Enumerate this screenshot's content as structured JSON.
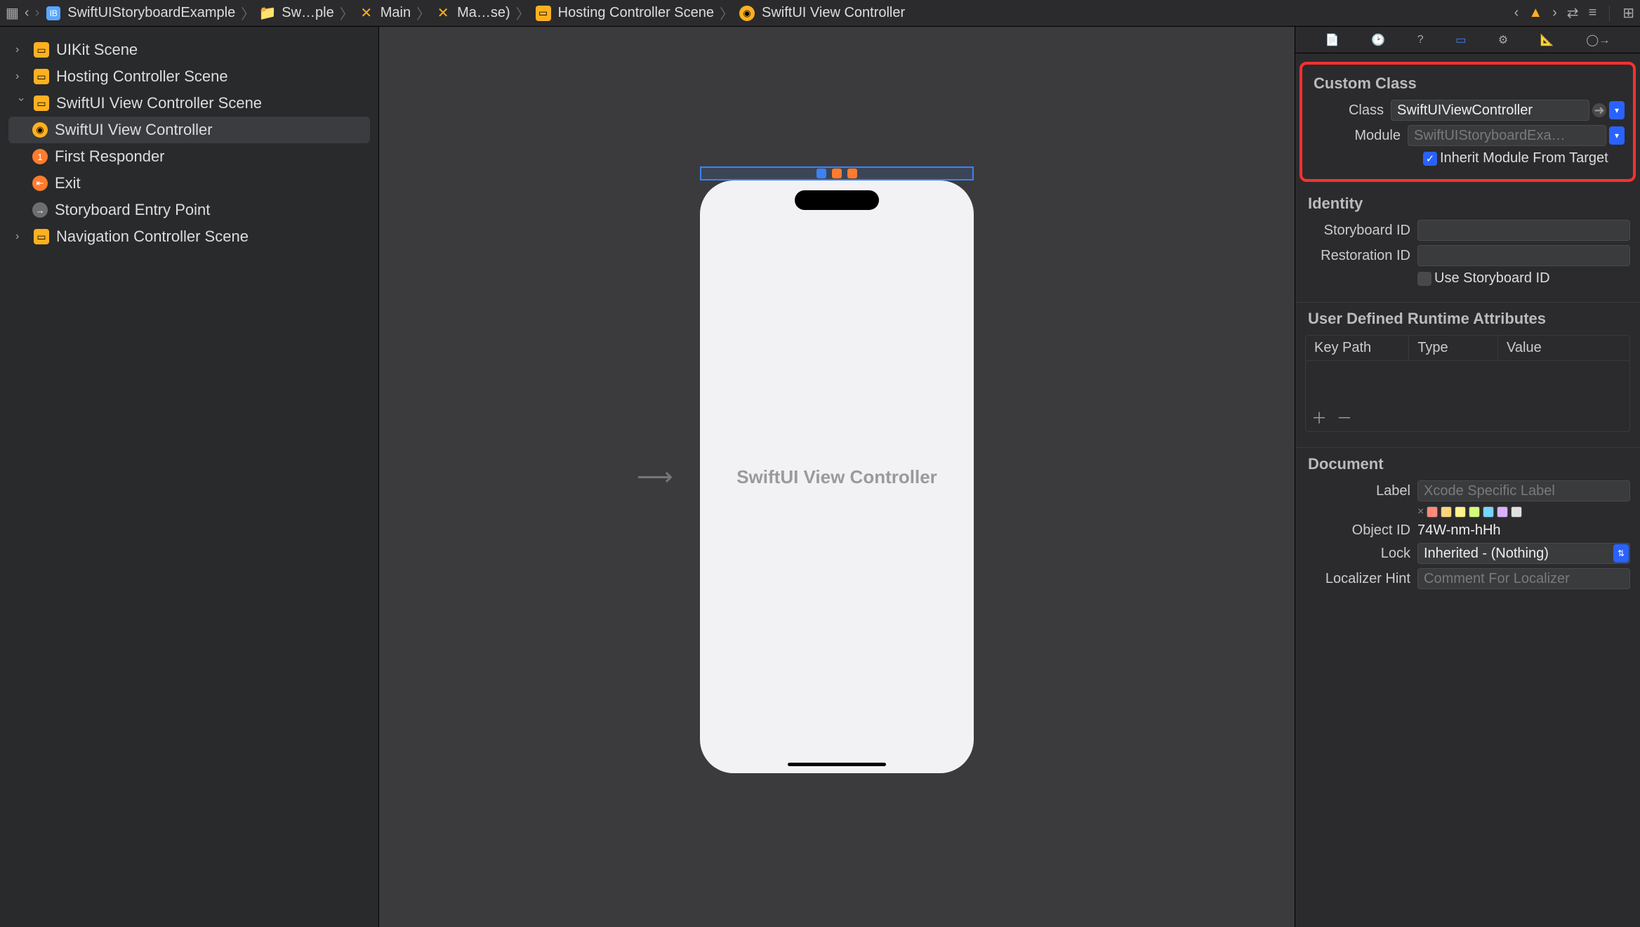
{
  "toolbar": {
    "breadcrumb": [
      {
        "icon": "storyboard",
        "label": "SwiftUIStoryboardExample"
      },
      {
        "icon": "folder",
        "label": "Sw…ple"
      },
      {
        "icon": "x",
        "label": "Main"
      },
      {
        "icon": "x",
        "label": "Ma…se)"
      },
      {
        "icon": "scene",
        "label": "Hosting Controller Scene"
      },
      {
        "icon": "vc",
        "label": "SwiftUI View Controller"
      }
    ],
    "warning_count": "1"
  },
  "outline": {
    "items": [
      {
        "label": "UIKit Scene",
        "depth": 0,
        "disclosure": "closed",
        "icon": "scene"
      },
      {
        "label": "Hosting Controller Scene",
        "depth": 0,
        "disclosure": "closed",
        "icon": "scene"
      },
      {
        "label": "SwiftUI View Controller Scene",
        "depth": 0,
        "disclosure": "open",
        "icon": "scene"
      },
      {
        "label": "SwiftUI View Controller",
        "depth": 1,
        "icon": "vc-yellow",
        "selected": true
      },
      {
        "label": "First Responder",
        "depth": 1,
        "icon": "first-responder"
      },
      {
        "label": "Exit",
        "depth": 1,
        "icon": "exit"
      },
      {
        "label": "Storyboard Entry Point",
        "depth": 1,
        "icon": "entry"
      },
      {
        "label": "Navigation Controller Scene",
        "depth": 0,
        "disclosure": "closed",
        "icon": "scene"
      }
    ]
  },
  "canvas": {
    "vc_label": "SwiftUI View Controller"
  },
  "inspector": {
    "custom_class": {
      "title": "Custom Class",
      "class_label": "Class",
      "class_value": "SwiftUIViewController",
      "module_label": "Module",
      "module_placeholder": "SwiftUIStoryboardExa…",
      "inherit_label": "Inherit Module From Target",
      "inherit_checked": true
    },
    "identity": {
      "title": "Identity",
      "storyboard_id_label": "Storyboard ID",
      "storyboard_id_value": "",
      "restoration_id_label": "Restoration ID",
      "restoration_id_value": "",
      "use_storyboard_id_label": "Use Storyboard ID"
    },
    "runtime_attrs": {
      "title": "User Defined Runtime Attributes",
      "col_keypath": "Key Path",
      "col_type": "Type",
      "col_value": "Value"
    },
    "document": {
      "title": "Document",
      "label_label": "Label",
      "label_placeholder": "Xcode Specific Label",
      "colors": [
        "#ff8a7a",
        "#ffd479",
        "#fff28a",
        "#d4fb79",
        "#76d6ff",
        "#d8b0ff",
        "#e0e0e0"
      ],
      "object_id_label": "Object ID",
      "object_id_value": "74W-nm-hHh",
      "lock_label": "Lock",
      "lock_value": "Inherited - (Nothing)",
      "localizer_hint_label": "Localizer Hint",
      "localizer_hint_placeholder": "Comment For Localizer"
    }
  }
}
